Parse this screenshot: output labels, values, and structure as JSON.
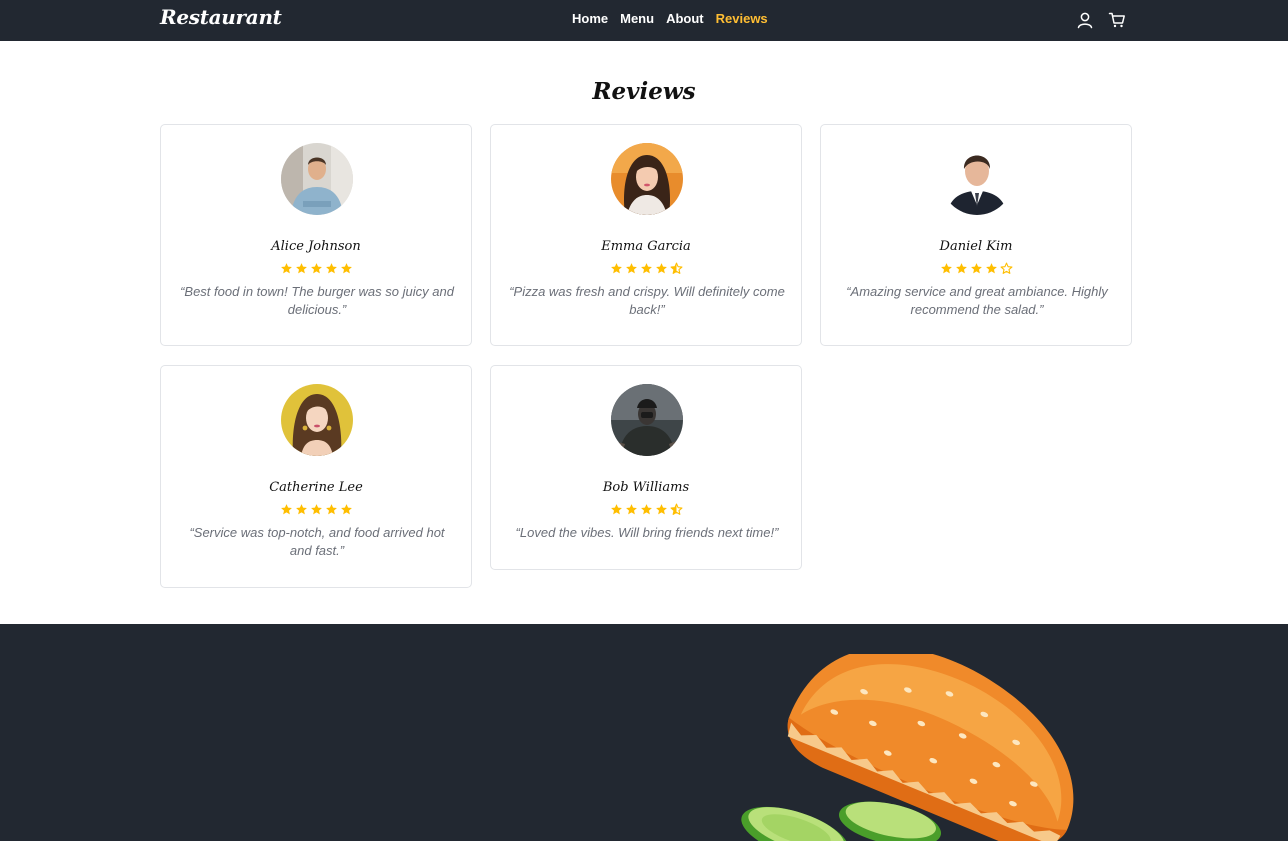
{
  "nav": {
    "brand": "Restaurant",
    "links": [
      {
        "label": "Home",
        "active": false
      },
      {
        "label": "Menu",
        "active": false
      },
      {
        "label": "About",
        "active": false
      },
      {
        "label": "Reviews",
        "active": true
      }
    ],
    "icons": [
      "user-icon",
      "cart-icon"
    ]
  },
  "reviews": {
    "title": "Reviews",
    "items": [
      {
        "name": "Alice Johnson",
        "rating": 5,
        "quote": "“Best food in town! The burger was so juicy and delicious.”"
      },
      {
        "name": "Emma Garcia",
        "rating": 4.5,
        "quote": "“Pizza was fresh and crispy. Will definitely come back!”"
      },
      {
        "name": "Daniel Kim",
        "rating": 4,
        "quote": "“Amazing service and great ambiance. Highly recommend the salad.”"
      },
      {
        "name": "Catherine Lee",
        "rating": 5,
        "quote": "“Service was top-notch, and food arrived hot and fast.”"
      },
      {
        "name": "Bob Williams",
        "rating": 4.5,
        "quote": "“Loved the vibes. Will bring friends next time!”"
      }
    ]
  },
  "colors": {
    "nav_bg": "#222831",
    "accent": "#ffbe33",
    "star": "#ffbe00"
  }
}
